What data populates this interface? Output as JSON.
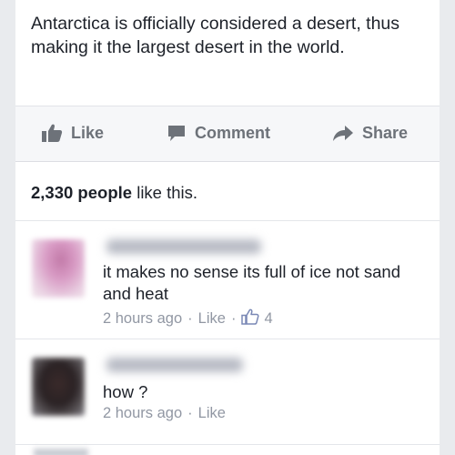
{
  "post": {
    "text": "Antarctica is officially considered a desert, thus making it the largest desert in the world."
  },
  "actions": {
    "like_label": "Like",
    "comment_label": "Comment",
    "share_label": "Share"
  },
  "likes": {
    "count": "2,330 people",
    "suffix": " like this."
  },
  "comments": [
    {
      "text": "it makes no sense its full of ice not sand and heat",
      "time": "2 hours ago",
      "like_label": "Like",
      "like_count": "4"
    },
    {
      "text": "how ?",
      "time": "2 hours ago",
      "like_label": "Like"
    }
  ],
  "colors": {
    "background": "#e9ebee",
    "card": "#ffffff",
    "action_text": "#6d7279",
    "meta_text": "#9197a3"
  },
  "icons": {
    "like": "thumbs-up-icon",
    "comment": "speech-bubble-icon",
    "share": "share-arrow-icon",
    "comment_like": "thumbs-up-outline-icon"
  }
}
